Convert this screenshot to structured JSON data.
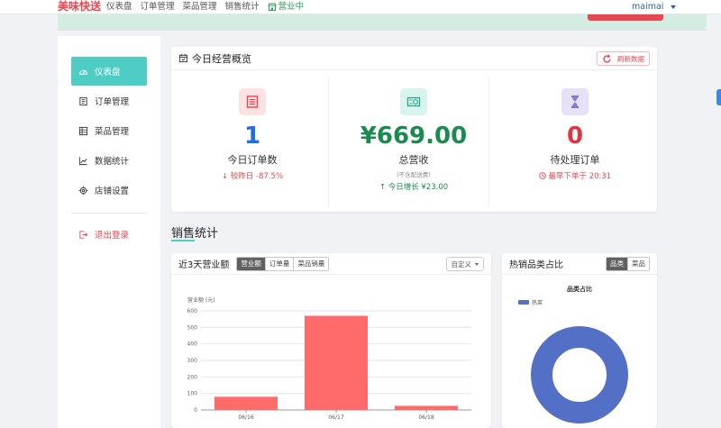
{
  "topbar": {
    "brand": "美味快送",
    "nav": [
      "仪表盘",
      "订单管理",
      "菜品管理",
      "销售统计"
    ],
    "status": "营业中",
    "user": "maimai"
  },
  "sidebar": {
    "items": [
      {
        "label": "仪表盘",
        "icon": "dashboard-icon"
      },
      {
        "label": "订单管理",
        "icon": "order-icon"
      },
      {
        "label": "菜品管理",
        "icon": "menu-list-icon"
      },
      {
        "label": "数据统计",
        "icon": "line-chart-icon"
      },
      {
        "label": "店铺设置",
        "icon": "gear-icon"
      }
    ],
    "logout": "退出登录"
  },
  "overview": {
    "title": "今日经营概览",
    "refresh": "刷新数据",
    "stats": [
      {
        "value": "1",
        "label": "今日订单数",
        "note": "较昨日 -87.5%",
        "sub": "",
        "color": "#1f6fe0"
      },
      {
        "value": "¥669.00",
        "label": "总营收",
        "sub": "(不含配送费)",
        "note": "今日增长 ¥23.00",
        "color": "#1a8a4f"
      },
      {
        "value": "0",
        "label": "待处理订单",
        "note": "最早下单于 20:31",
        "sub": "",
        "color": "#e03440"
      }
    ]
  },
  "section": {
    "title": "销售统计"
  },
  "sales": {
    "title": "近3天营业额",
    "tabs": [
      "营业额",
      "订单量",
      "菜品销量"
    ],
    "active_tab": 0,
    "dropdown": "自定义"
  },
  "hot": {
    "title": "热销品类占比",
    "tabs": [
      "品类",
      "菜品"
    ],
    "active_tab": 0
  },
  "chart_data": [
    {
      "type": "bar",
      "title": "",
      "ylabel": "营业额 (元)",
      "xlabel": "",
      "categories": [
        "06/16",
        "06/17",
        "06/18"
      ],
      "values": [
        80,
        570,
        25
      ],
      "ylim": [
        0,
        600
      ],
      "yticks": [
        0,
        100,
        200,
        300,
        400,
        500,
        600
      ],
      "grid": true,
      "color": "#ff6b6b"
    },
    {
      "type": "pie",
      "title": "品类占比",
      "labels": [
        "热菜"
      ],
      "values": [
        100
      ],
      "colors": [
        "#5470c6"
      ],
      "donut": true,
      "legend": "top-left"
    }
  ]
}
